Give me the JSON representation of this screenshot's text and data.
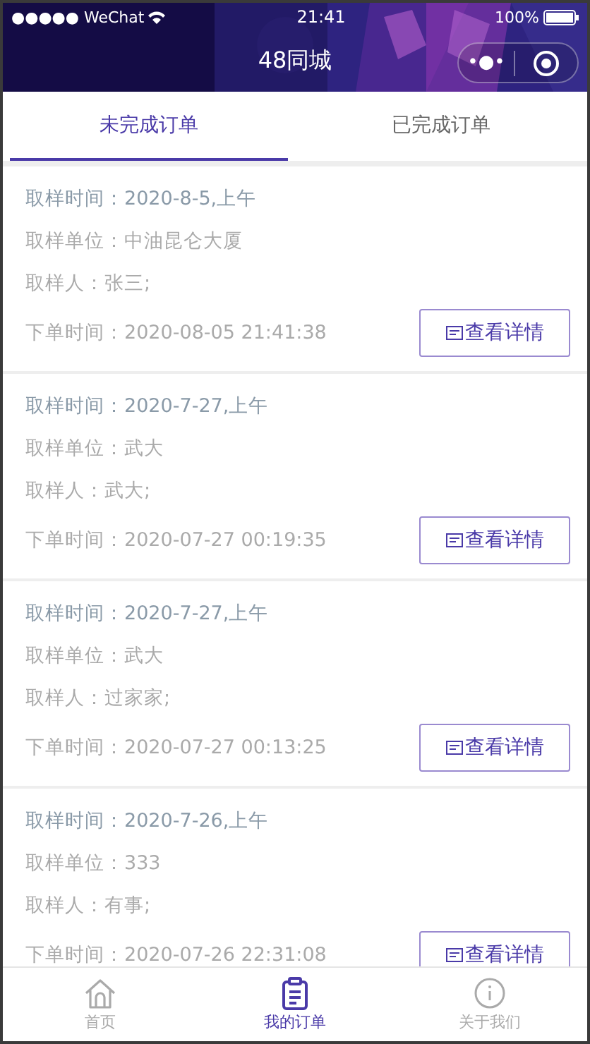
{
  "status_bar": {
    "carrier": "●●●●● WeChat",
    "time": "21:41",
    "battery": "100%"
  },
  "nav": {
    "title": "48同城",
    "menu": "•●•"
  },
  "tabs": [
    {
      "label": "未完成订单",
      "selected": true
    },
    {
      "label": "已完成订单",
      "selected": false
    }
  ],
  "orders": [
    {
      "sample_time": "取样时间：2020-8-5,上午",
      "sample_unit": "取样单位：中油昆仑大厦",
      "sampler": "取样人：张三;",
      "order_time": "下单时间：2020-08-05 21:41:38",
      "button": "查看详情"
    },
    {
      "sample_time": "取样时间：2020-7-27,上午",
      "sample_unit": "取样单位：武大",
      "sampler": "取样人：武大;",
      "order_time": "下单时间：2020-07-27 00:19:35",
      "button": "查看详情"
    },
    {
      "sample_time": "取样时间：2020-7-27,上午",
      "sample_unit": "取样单位：武大",
      "sampler": "取样人：过家家;",
      "order_time": "下单时间：2020-07-27 00:13:25",
      "button": "查看详情"
    },
    {
      "sample_time": "取样时间：2020-7-26,上午",
      "sample_unit": "取样单位：333",
      "sampler": "取样人：有事;",
      "order_time": "下单时间：2020-07-26 22:31:08",
      "button": "查看详情"
    }
  ],
  "tab_bar": [
    {
      "label": "首页",
      "kind": "home",
      "selected": false
    },
    {
      "label": "我的订单",
      "kind": "orders",
      "selected": true
    },
    {
      "label": "关于我们",
      "kind": "about",
      "selected": false
    }
  ]
}
